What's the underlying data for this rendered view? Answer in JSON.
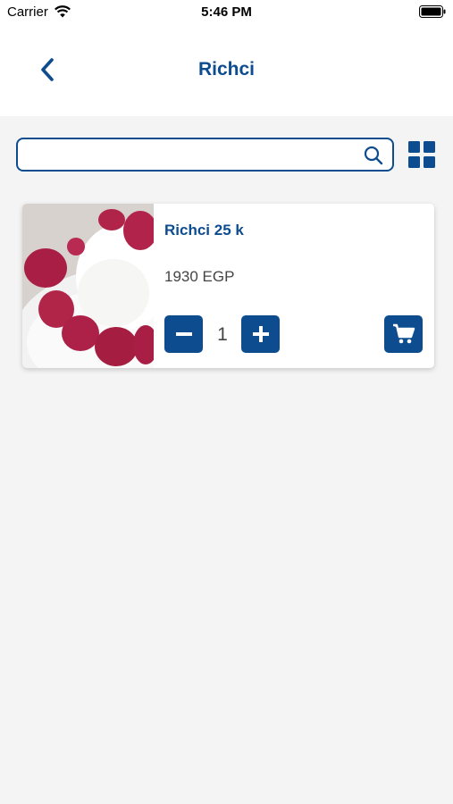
{
  "status_bar": {
    "carrier": "Carrier",
    "time": "5:46 PM"
  },
  "nav": {
    "title": "Richci",
    "back_icon": "chevron-left-icon"
  },
  "search": {
    "value": "",
    "placeholder": "",
    "icon": "search-icon"
  },
  "view_toggle": {
    "icon": "grid-view-icon"
  },
  "products": [
    {
      "name": "Richci 25 k",
      "price": "1930 EGP",
      "quantity": "1",
      "image": "raspberries-cream-photo"
    }
  ],
  "colors": {
    "accent": "#0d4c8f",
    "background": "#f4f4f4",
    "card": "#ffffff"
  }
}
